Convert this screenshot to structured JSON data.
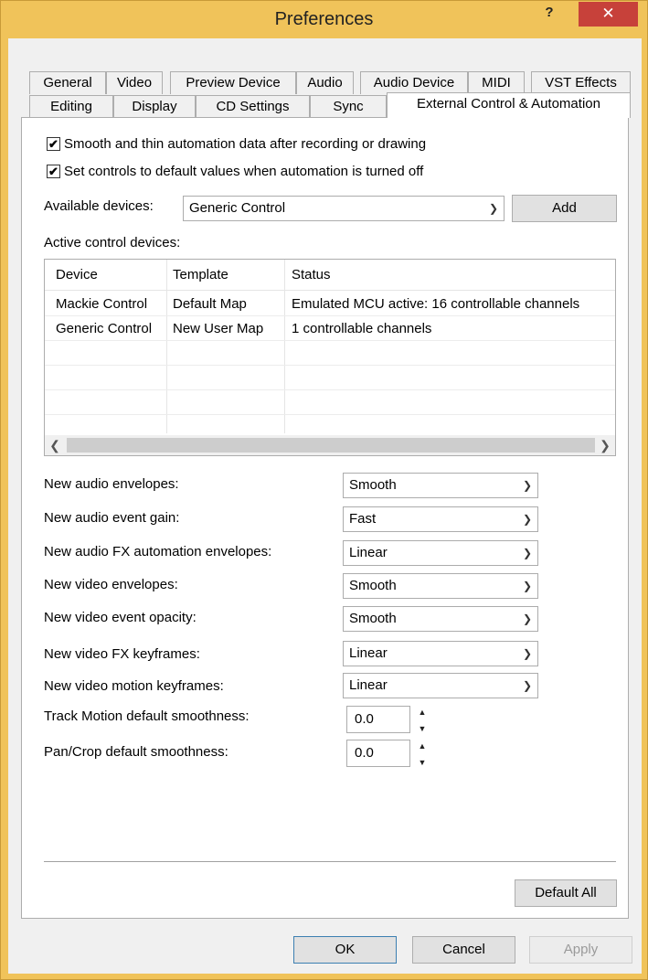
{
  "window": {
    "title": "Preferences",
    "help_label": "?",
    "close_label": "✕"
  },
  "tabs_row1": [
    {
      "label": "General"
    },
    {
      "label": "Video"
    },
    {
      "label": "Preview Device"
    },
    {
      "label": "Audio"
    },
    {
      "label": "Audio Device"
    },
    {
      "label": "MIDI"
    },
    {
      "label": "VST Effects"
    }
  ],
  "tabs_row2": [
    {
      "label": "Editing"
    },
    {
      "label": "Display"
    },
    {
      "label": "CD Settings"
    },
    {
      "label": "Sync"
    },
    {
      "label": "External Control & Automation",
      "active": true
    }
  ],
  "options": {
    "smooth_thin": {
      "label": "Smooth and thin automation data after recording or drawing",
      "checked": true
    },
    "set_defaults": {
      "label": "Set controls to default values when automation is turned off",
      "checked": true
    }
  },
  "available_devices": {
    "label": "Available devices:",
    "value": "Generic Control",
    "add_label": "Add"
  },
  "active_devices": {
    "label": "Active control devices:",
    "columns": [
      "Device",
      "Template",
      "Status"
    ],
    "rows": [
      [
        "Mackie Control",
        "Default Map",
        "Emulated MCU active: 16 controllable channels"
      ],
      [
        "Generic Control",
        "New User Map",
        "1 controllable channels"
      ]
    ]
  },
  "settings": [
    {
      "label": "New audio envelopes:",
      "value": "Smooth"
    },
    {
      "label": "New audio event gain:",
      "value": "Fast"
    },
    {
      "label": "New audio FX automation envelopes:",
      "value": "Linear"
    },
    {
      "label": "New video envelopes:",
      "value": "Smooth"
    },
    {
      "label": "New video event opacity:",
      "value": "Smooth"
    },
    {
      "label": "New video FX keyframes:",
      "value": "Linear"
    },
    {
      "label": "New video motion keyframes:",
      "value": "Linear"
    }
  ],
  "smoothness": [
    {
      "label": "Track Motion default smoothness:",
      "value": "0.0"
    },
    {
      "label": "Pan/Crop default smoothness:",
      "value": "0.0"
    }
  ],
  "buttons": {
    "default_all": "Default All",
    "ok": "OK",
    "cancel": "Cancel",
    "apply": "Apply"
  },
  "colors": {
    "title_bar": "#f0c35a",
    "close_button": "#c7413a"
  }
}
